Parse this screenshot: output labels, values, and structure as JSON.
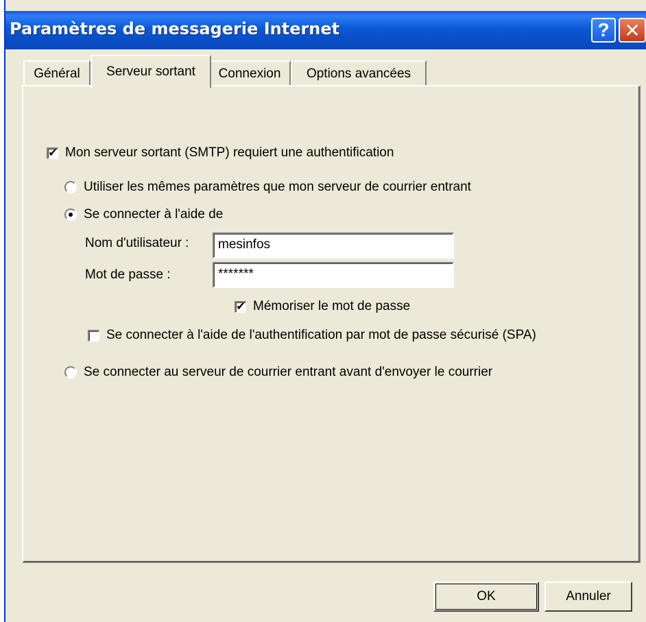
{
  "window": {
    "title": "Paramètres de messagerie Internet",
    "help_label": "?",
    "close_label": "✕"
  },
  "tabs": [
    {
      "label": "Général"
    },
    {
      "label": "Serveur sortant"
    },
    {
      "label": "Connexion"
    },
    {
      "label": "Options avancées"
    }
  ],
  "outgoing": {
    "auth_required": {
      "label": "Mon serveur sortant (SMTP) requiert une authentification",
      "checked": true
    },
    "option_same": {
      "label": "Utiliser les mêmes paramètres que mon serveur de courrier entrant",
      "selected": false
    },
    "option_login": {
      "label": "Se connecter à l'aide de",
      "selected": true
    },
    "username": {
      "label": "Nom d'utilisateur :",
      "value": "mesinfos"
    },
    "password": {
      "label": "Mot de passe :",
      "value": "*******"
    },
    "remember": {
      "label": "Mémoriser le mot de passe",
      "checked": true
    },
    "spa": {
      "label": "Se connecter à l'aide de l'authentification par mot de passe sécurisé (SPA)",
      "checked": false
    },
    "option_before": {
      "label": "Se connecter au serveur de courrier entrant avant d'envoyer le courrier",
      "selected": false
    }
  },
  "buttons": {
    "ok": "OK",
    "cancel": "Annuler"
  },
  "check_glyph": "✔"
}
